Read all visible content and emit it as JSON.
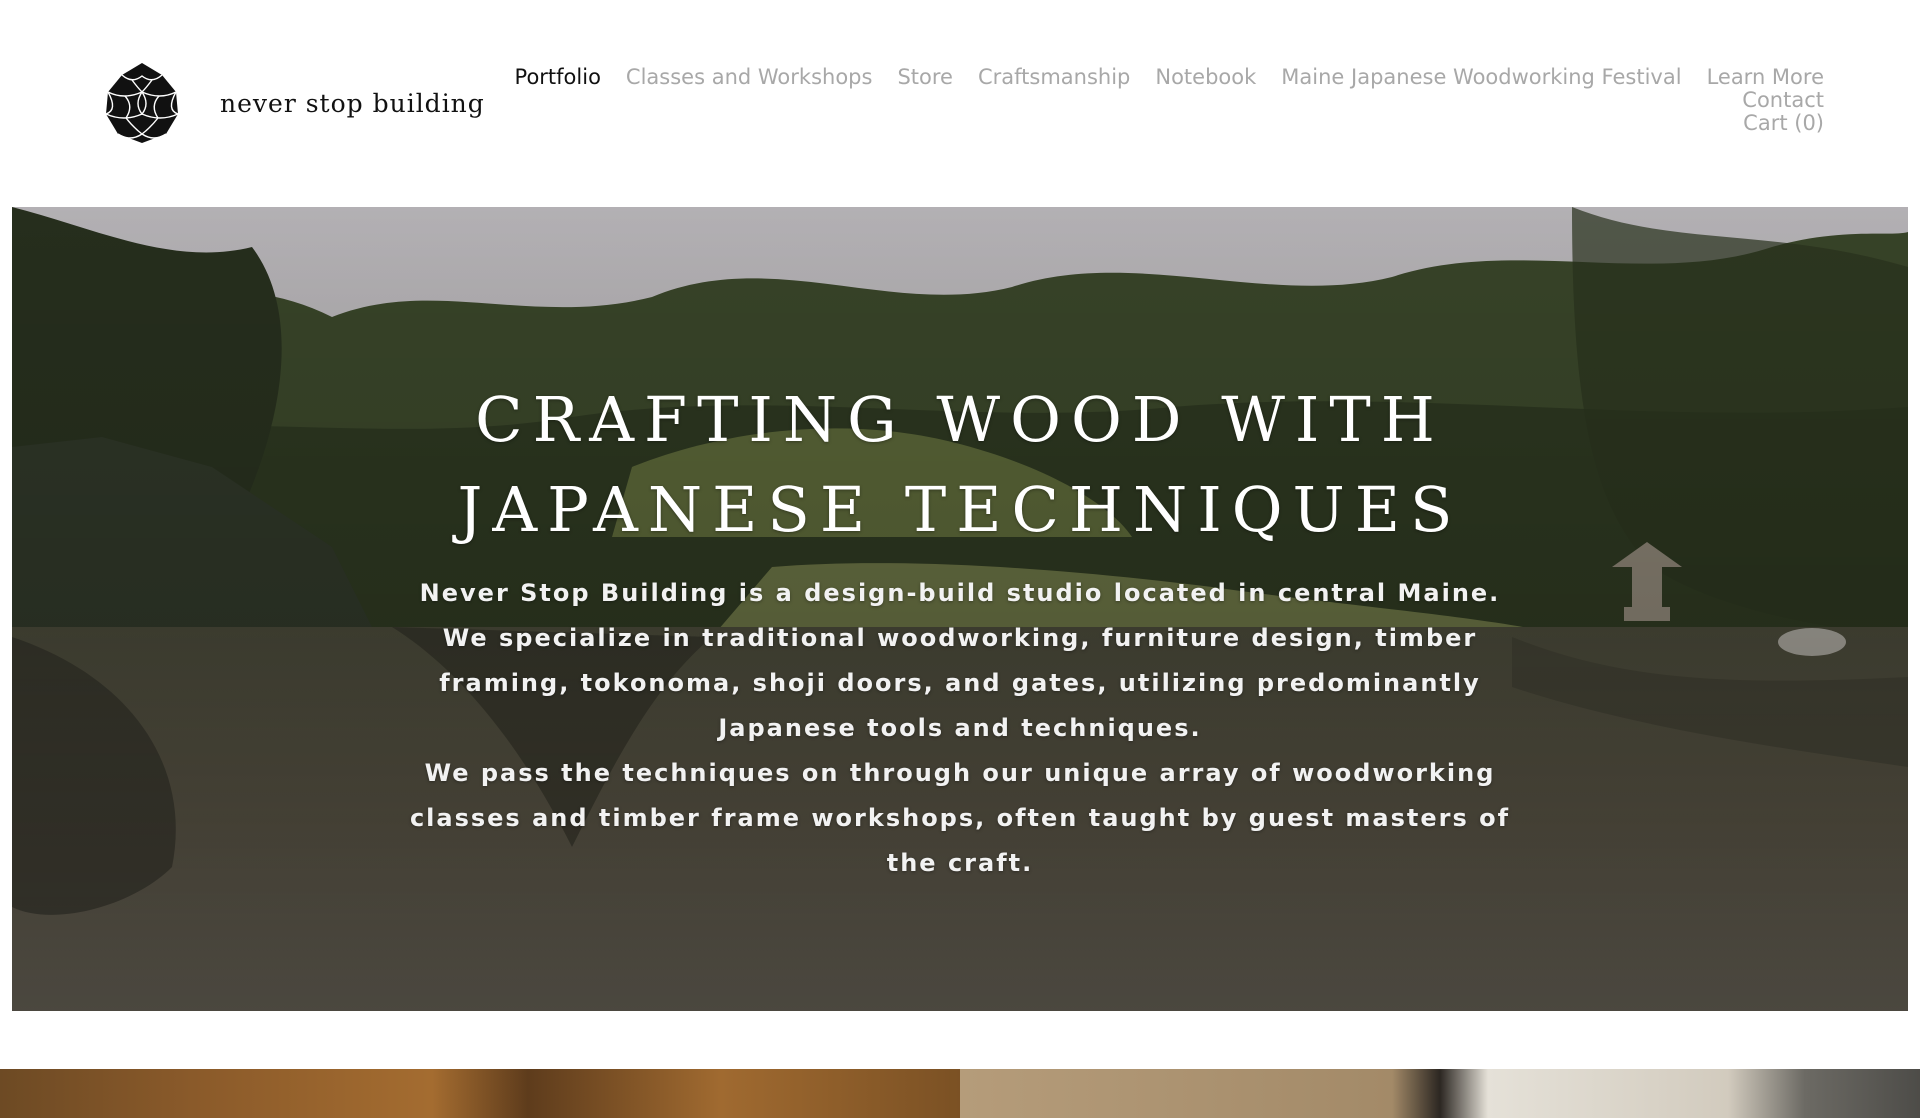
{
  "site": {
    "title": "never stop building"
  },
  "nav": {
    "items": [
      {
        "label": "Portfolio",
        "active": true
      },
      {
        "label": "Classes and Workshops"
      },
      {
        "label": "Store"
      },
      {
        "label": "Craftsmanship"
      },
      {
        "label": "Notebook"
      },
      {
        "label": "Maine Japanese Woodworking Festival"
      },
      {
        "label": "Learn More"
      }
    ],
    "secondary": [
      {
        "label": "Contact"
      },
      {
        "label": "Cart (0)"
      }
    ]
  },
  "hero": {
    "title": "CRAFTING WOOD WITH JAPANESE TECHNIQUES",
    "paragraph_1": "Never Stop Building is a design-build studio located in central Maine. We specialize in traditional woodworking, furniture design, timber framing, tokonoma, shoji doors, and gates, utilizing predominantly Japanese tools and techniques.",
    "paragraph_2": "We pass the techniques on through our unique array of woodworking classes and timber frame workshops, often taught by guest masters of the craft."
  },
  "colors": {
    "nav_active": "#111111",
    "nav_inactive": "#a8a8a8",
    "hero_text": "#ffffff"
  },
  "icons": {
    "logo": "pinecone-logo-icon"
  }
}
